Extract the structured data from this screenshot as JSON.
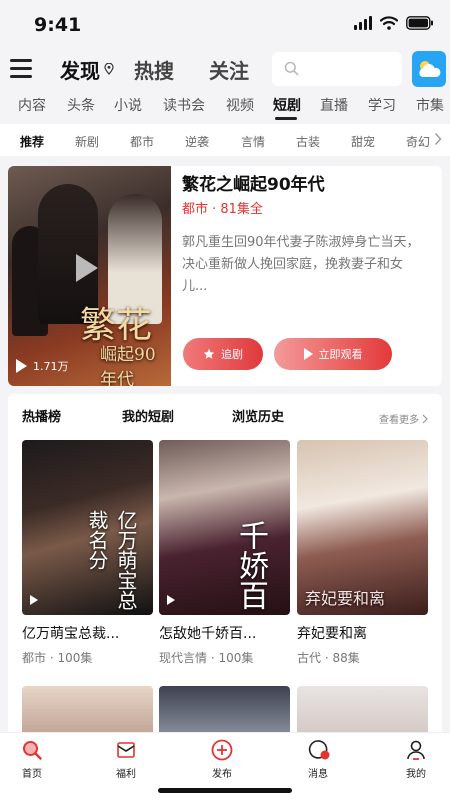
{
  "status_bar": {
    "time": "9:41"
  },
  "header": {
    "tabs": [
      {
        "label": "发现",
        "active": true
      },
      {
        "label": "热搜",
        "active": false
      },
      {
        "label": "关注",
        "active": false
      }
    ],
    "search": {
      "placeholder": ""
    },
    "weather_icon": "weather-cloud-sun-icon"
  },
  "channels": [
    "内容",
    "头条",
    "小说",
    "读书会",
    "视频",
    "短剧",
    "直播",
    "学习",
    "市集"
  ],
  "active_channel": "短剧",
  "subcategories": [
    "推荐",
    "新剧",
    "都市",
    "逆袭",
    "言情",
    "古装",
    "甜宠",
    "奇幻"
  ],
  "featured": {
    "title": "繁花之崛起90年代",
    "meta": "都市 · 81集全",
    "description": "郭凡重生回90年代妻子陈淑婷身亡当天，决心重新做人挽回家庭，挽救妻子和女儿...",
    "poster_title": "繁花",
    "poster_subtitle": "崛起90年代",
    "views": "1.71万",
    "follow_label": "追剧",
    "watch_label": "立即观看"
  },
  "hot": {
    "tabs": [
      "热播榜",
      "我的短剧",
      "浏览历史"
    ],
    "more_label": "查看更多",
    "cards": [
      {
        "name": "亿万萌宝总裁...",
        "meta": "都市 · 100集",
        "cover_text": "亿万萌宝总裁名分"
      },
      {
        "name": "怎敌她千娇百...",
        "meta": "现代言情 · 100集",
        "cover_text": "千娇百"
      },
      {
        "name": "弃妃要和离",
        "meta": "古代 · 88集",
        "cover_text": "弃妃要和离"
      }
    ]
  },
  "bottom_nav": [
    {
      "label": "首页",
      "icon": "home-icon"
    },
    {
      "label": "福利",
      "icon": "gift-icon"
    },
    {
      "label": "发布",
      "icon": "publish-plus-icon"
    },
    {
      "label": "消息",
      "icon": "message-icon"
    },
    {
      "label": "我的",
      "icon": "profile-icon"
    }
  ],
  "colors": {
    "accent": "#e3342f",
    "weather": "#27a5f3"
  }
}
